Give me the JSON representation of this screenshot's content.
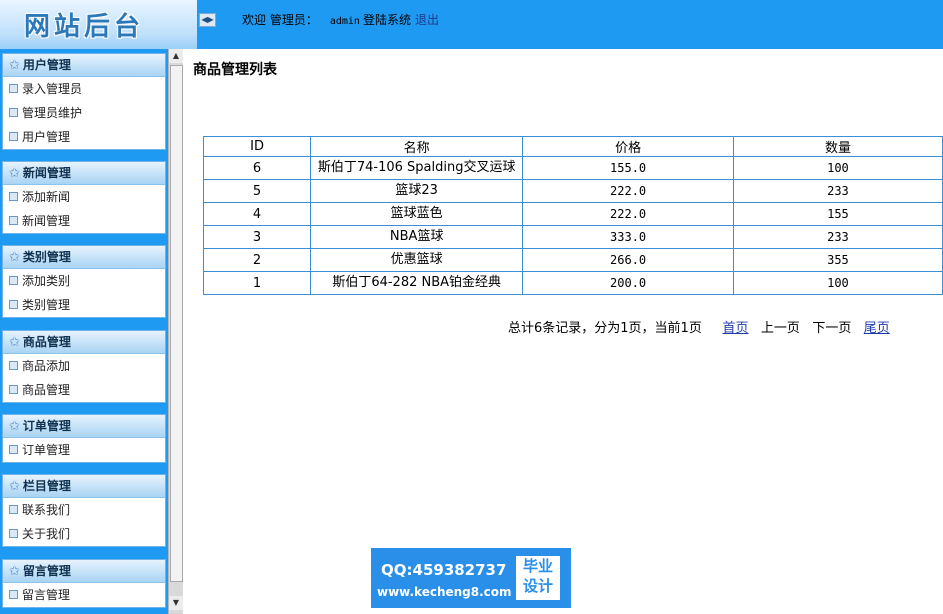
{
  "header": {
    "logo_text": "网站后台",
    "toggle_icon": "◀▶",
    "welcome_label": "欢迎 管理员：",
    "username": "admin",
    "login_text": "登陆系统",
    "logout_label": "退出",
    "bar_color": "#1f9af2"
  },
  "sidebar": {
    "panels": [
      {
        "title": "用户管理",
        "items": [
          "录入管理员",
          "管理员维护",
          "用户管理"
        ]
      },
      {
        "title": "新闻管理",
        "items": [
          "添加新闻",
          "新闻管理"
        ]
      },
      {
        "title": "类别管理",
        "items": [
          "添加类别",
          "类别管理"
        ]
      },
      {
        "title": "商品管理",
        "items": [
          "商品添加",
          "商品管理"
        ]
      },
      {
        "title": "订单管理",
        "items": [
          "订单管理"
        ]
      },
      {
        "title": "栏目管理",
        "items": [
          "联系我们",
          "关于我们"
        ]
      },
      {
        "title": "留言管理",
        "items": [
          "留言管理"
        ]
      }
    ]
  },
  "main": {
    "page_title": "商品管理列表",
    "table": {
      "columns": [
        "ID",
        "名称",
        "价格",
        "数量"
      ],
      "rows": [
        [
          "6",
          "斯伯丁74-106 Spalding交叉运球",
          "155.0",
          "100"
        ],
        [
          "5",
          "篮球23",
          "222.0",
          "233"
        ],
        [
          "4",
          "篮球蓝色",
          "222.0",
          "155"
        ],
        [
          "3",
          "NBA篮球",
          "333.0",
          "233"
        ],
        [
          "2",
          "优惠篮球",
          "266.0",
          "355"
        ],
        [
          "1",
          "斯伯丁64-282 NBA铂金经典",
          "200.0",
          "100"
        ]
      ]
    },
    "pager": {
      "summary": "总计6条记录，分为1页，当前1页",
      "first": "首页",
      "prev": "上一页",
      "next": "下一页",
      "last": "尾页"
    }
  },
  "watermark": {
    "qq": "QQ:459382737",
    "url": "www.kecheng8.com",
    "badge_line1": "毕业",
    "badge_line2": "设计"
  }
}
